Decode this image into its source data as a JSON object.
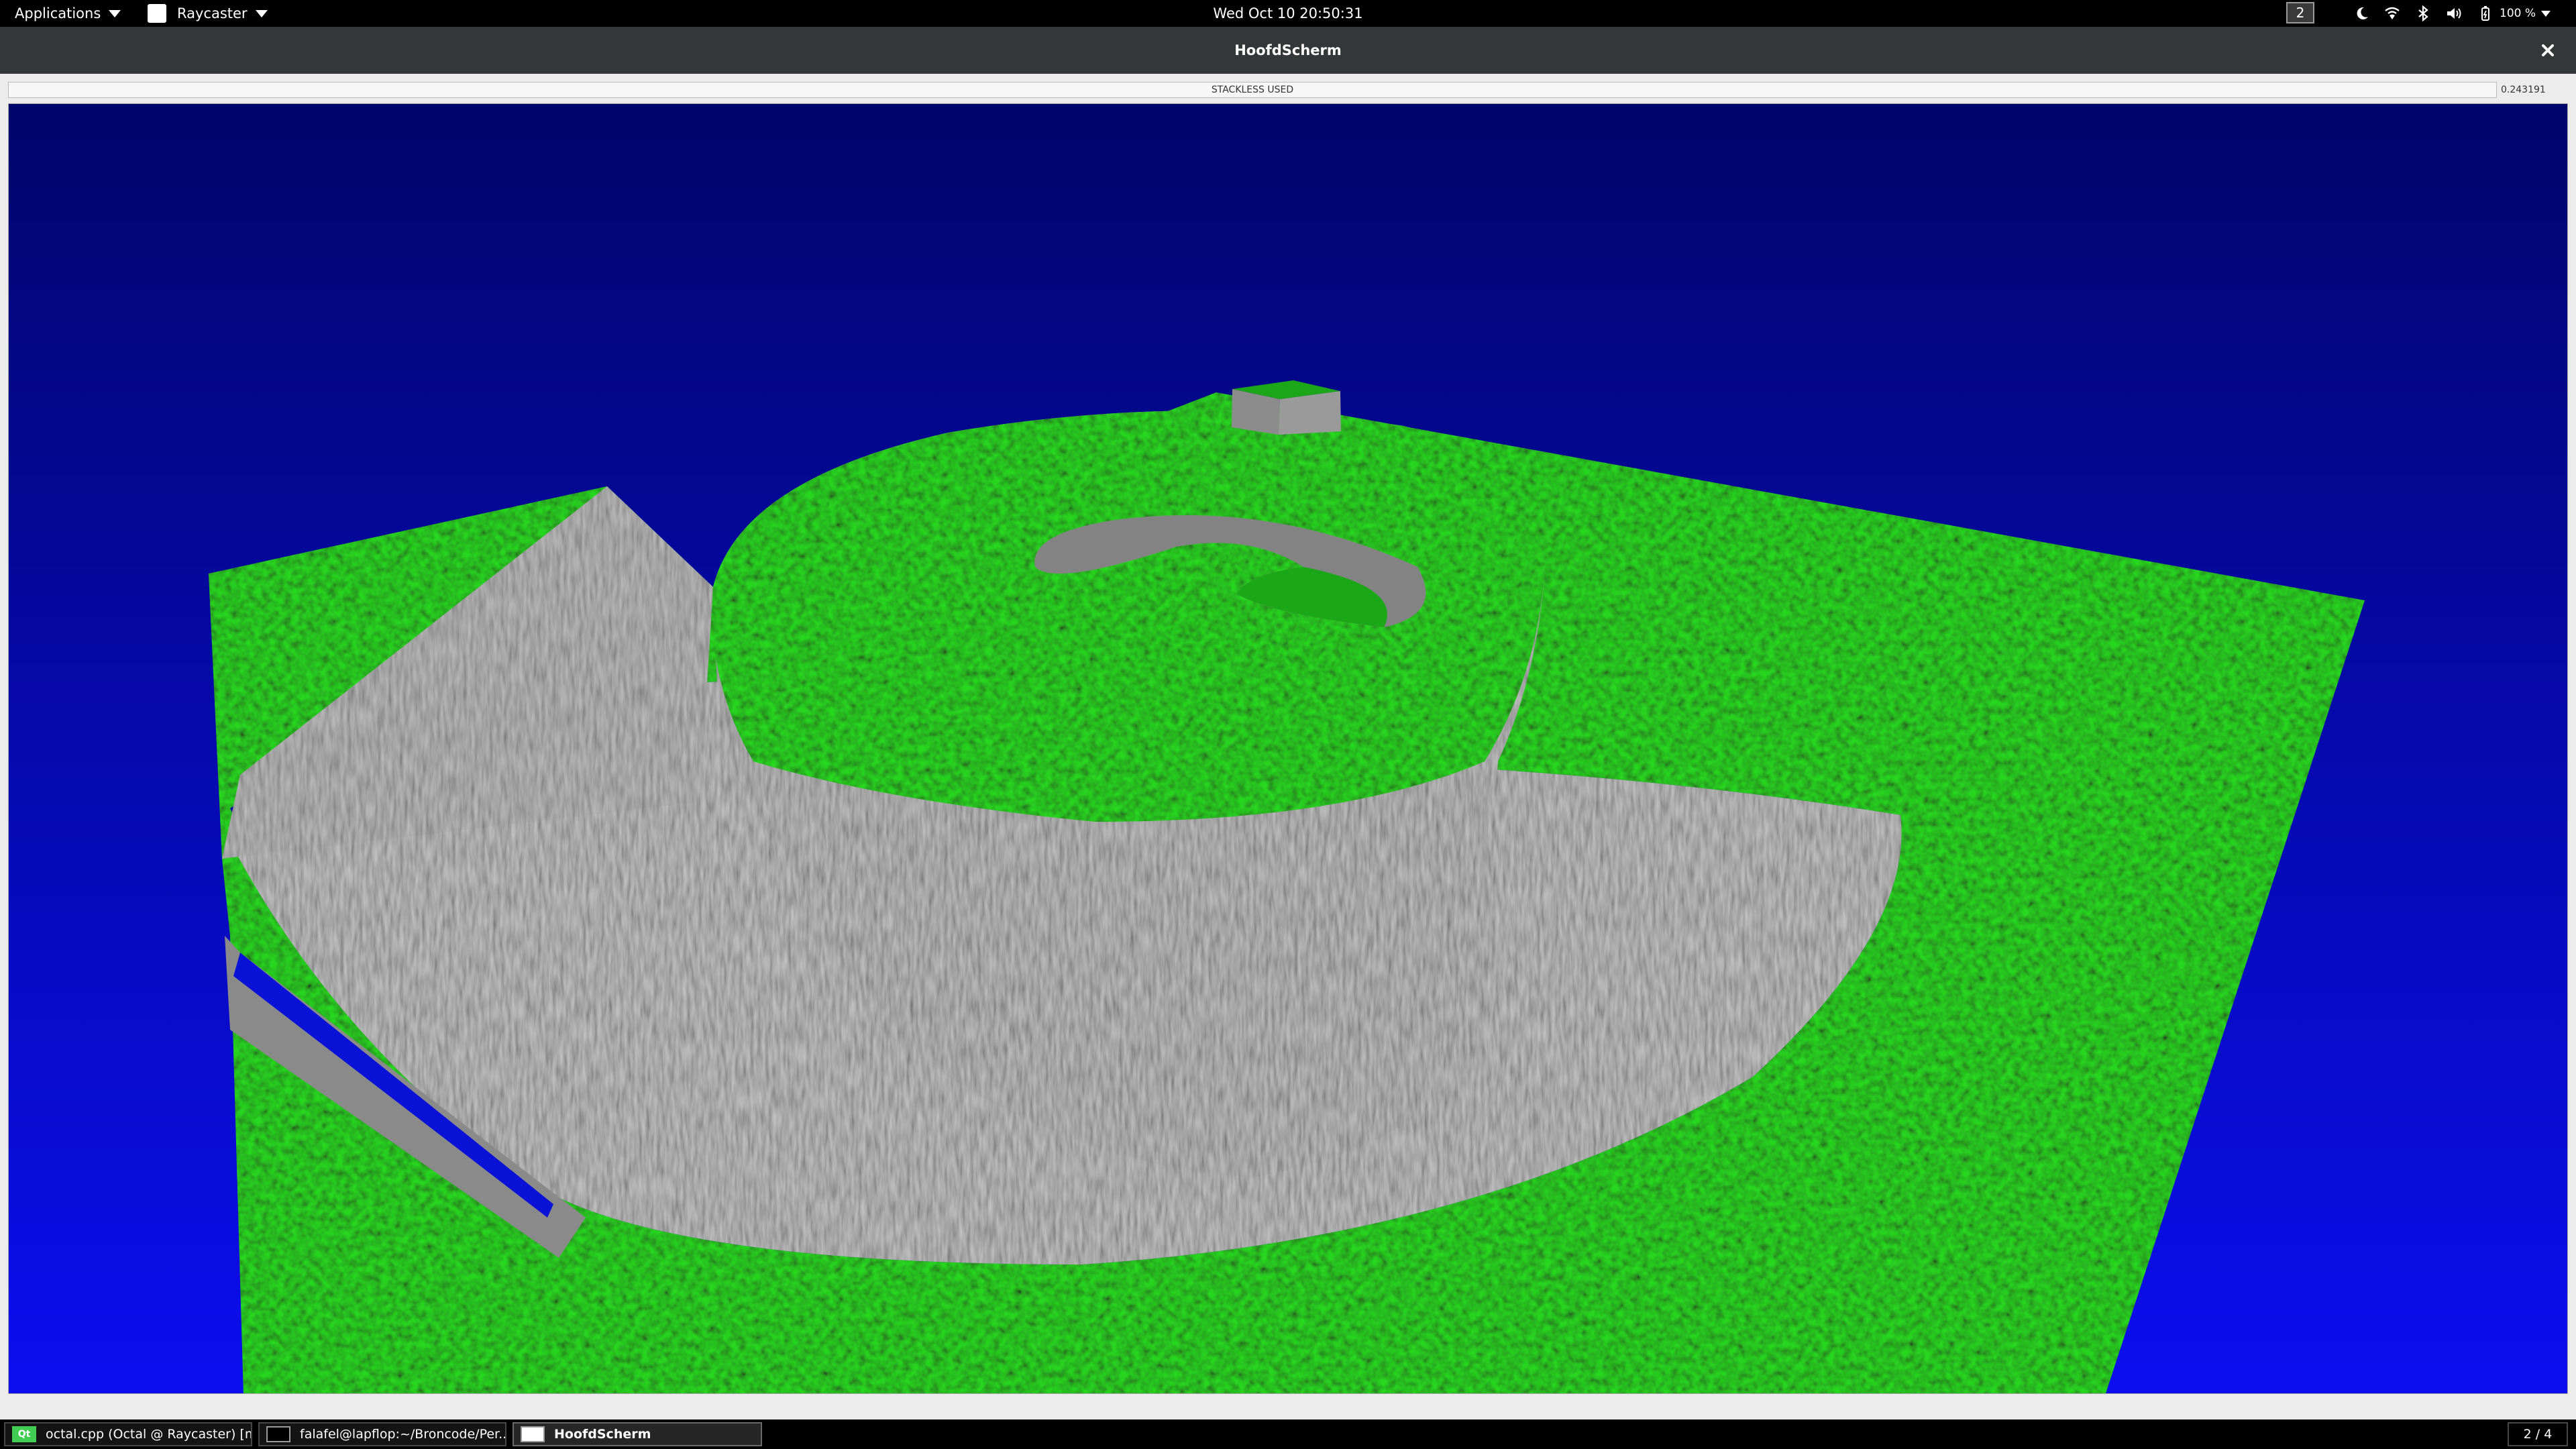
{
  "top_panel": {
    "applications_label": "Applications",
    "focused_app_label": "Raycaster",
    "clock": "Wed Oct 10  20:50:31",
    "workspace_number": "2",
    "battery_text": "100 %",
    "tray_icons": [
      "night-light-icon",
      "wifi-icon",
      "bluetooth-icon",
      "volume-icon",
      "battery-icon"
    ]
  },
  "window": {
    "title": "HoofdScherm",
    "status_text": "STACKLESS USED",
    "timing_value": "0.243191"
  },
  "scene": {
    "sky_top_color": "#00056b",
    "sky_bottom_color": "#0c0ef0",
    "grass_color": "#1aa818",
    "wall_color": "#8e8e8e"
  },
  "taskbar": {
    "tasks": [
      {
        "label": "octal.cpp (Octal @ Raycaster) [m...",
        "icon": "qt-creator-icon",
        "icon_text": "Qt"
      },
      {
        "label": "falafel@lapflop:~/Broncode/Per...",
        "icon": "terminal-icon"
      },
      {
        "label": "HoofdScherm",
        "icon": "window-icon"
      }
    ],
    "workspace_pager": "2 / 4"
  }
}
